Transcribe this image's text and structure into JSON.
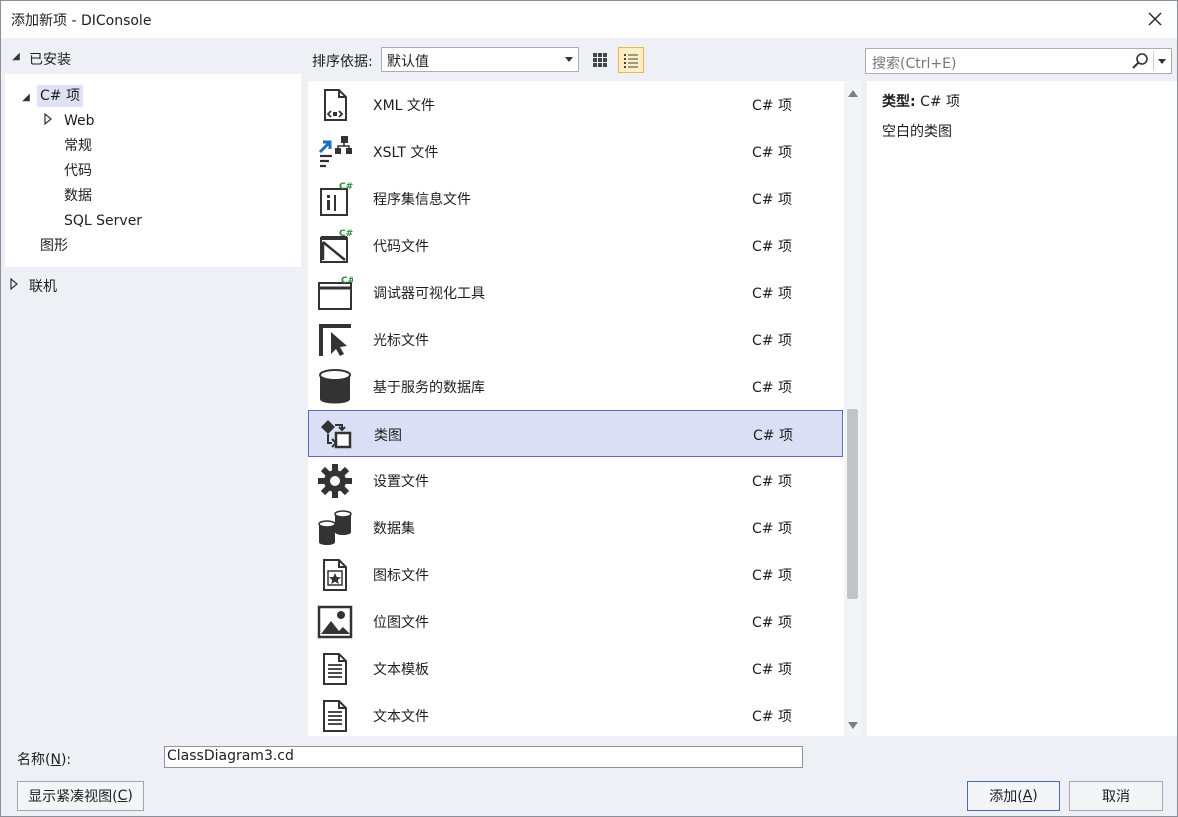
{
  "window": {
    "title": "添加新项 - DIConsole",
    "close_icon": "close-icon"
  },
  "left": {
    "installed_label": "已安装",
    "tree": {
      "root": "C# 项",
      "children": [
        "Web",
        "常规",
        "代码",
        "数据",
        "SQL Server"
      ],
      "graphics": "图形"
    },
    "online_label": "联机"
  },
  "toolbar": {
    "sort_label": "排序依据:",
    "sort_value": "默认值",
    "view_modes": [
      "small-icons-view",
      "list-view"
    ],
    "active_view": "list-view",
    "search_placeholder": "搜索(Ctrl+E)"
  },
  "items": [
    {
      "name": "XML 文件",
      "type": "C# 项",
      "icon": "xml-file-icon"
    },
    {
      "name": "XSLT 文件",
      "type": "C# 项",
      "icon": "xslt-file-icon"
    },
    {
      "name": "程序集信息文件",
      "type": "C# 项",
      "icon": "assembly-info-icon"
    },
    {
      "name": "代码文件",
      "type": "C# 项",
      "icon": "code-file-icon"
    },
    {
      "name": "调试器可视化工具",
      "type": "C# 项",
      "icon": "debugger-visualizer-icon"
    },
    {
      "name": "光标文件",
      "type": "C# 项",
      "icon": "cursor-file-icon"
    },
    {
      "name": "基于服务的数据库",
      "type": "C# 项",
      "icon": "database-icon"
    },
    {
      "name": "类图",
      "type": "C# 项",
      "icon": "class-diagram-icon",
      "selected": true
    },
    {
      "name": "设置文件",
      "type": "C# 项",
      "icon": "settings-file-icon"
    },
    {
      "name": "数据集",
      "type": "C# 项",
      "icon": "dataset-icon"
    },
    {
      "name": "图标文件",
      "type": "C# 项",
      "icon": "icon-file-icon"
    },
    {
      "name": "位图文件",
      "type": "C# 项",
      "icon": "bitmap-file-icon"
    },
    {
      "name": "文本模板",
      "type": "C# 项",
      "icon": "text-template-icon"
    },
    {
      "name": "文本文件",
      "type": "C# 项",
      "icon": "text-file-icon"
    }
  ],
  "details": {
    "type_label": "类型:",
    "type_value": "C# 项",
    "description": "空白的类图"
  },
  "bottom": {
    "name_label_pre": "名称(",
    "name_label_key": "N",
    "name_label_post": "):",
    "name_value": "ClassDiagram3.cd",
    "compact_pre": "显示紧凑视图(",
    "compact_key": "C",
    "compact_post": ")",
    "add_pre": "添加(",
    "add_key": "A",
    "add_post": ")",
    "cancel": "取消"
  },
  "colors": {
    "accent": "#5d6bbf",
    "selection": "#dadff6",
    "csharp_green": "#2e8b3a"
  }
}
